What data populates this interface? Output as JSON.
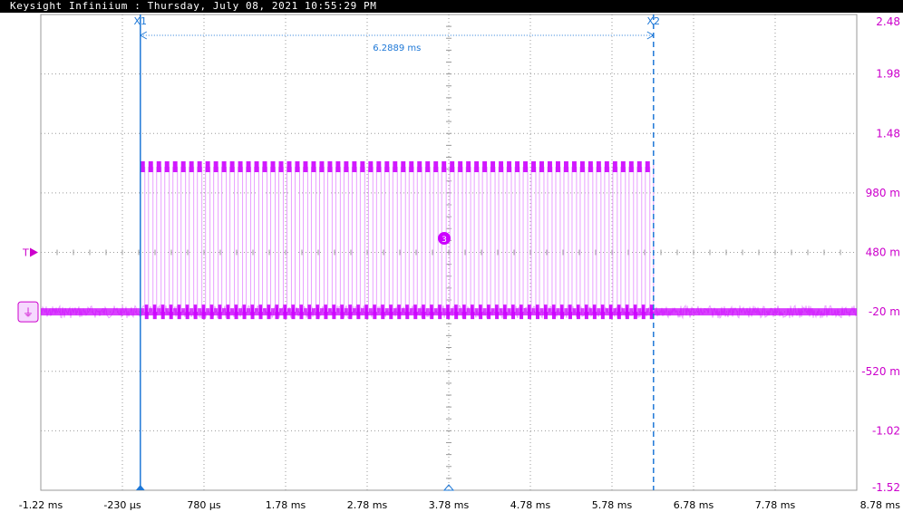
{
  "window": {
    "title": "Keysight Infiniium : Thursday, July 08, 2021 10:55:29 PM"
  },
  "colors": {
    "grid": "#9a9a9a",
    "trace": "#cc00ff",
    "trace_light": "#e9a0ff",
    "cursor": "#1e78d7",
    "y_labels": "#cc00cc",
    "x_labels": "#000000"
  },
  "markers": {
    "trigger_label": "T",
    "ground_label": "⏚",
    "channel_badge": "3"
  },
  "cursors": {
    "x1": {
      "label": "X1",
      "time_ms": -0.0
    },
    "x2": {
      "label": "X2",
      "time_ms": 6.2889
    },
    "delta_label": "6.2889 ms"
  },
  "chart_data": {
    "type": "line",
    "title": "",
    "xlabel": "",
    "ylabel": "",
    "x_tick_labels": [
      "-1.22 ms",
      "-230 µs",
      "780 µs",
      "1.78 ms",
      "2.78 ms",
      "3.78 ms",
      "4.78 ms",
      "5.78 ms",
      "6.78 ms",
      "7.78 ms",
      "8.78 ms"
    ],
    "x_ticks_ms": [
      -1.22,
      -0.23,
      0.78,
      1.78,
      2.78,
      3.78,
      4.78,
      5.78,
      6.78,
      7.78,
      8.78
    ],
    "y_tick_labels": [
      "2.48",
      "1.98",
      "1.48",
      "980 m",
      "480 m",
      "-20 m",
      "-520 m",
      "-1.02",
      "-1.52"
    ],
    "y_ticks_v": [
      2.48,
      1.98,
      1.48,
      0.98,
      0.48,
      -0.02,
      -0.52,
      -1.02,
      -1.52
    ],
    "xlim_ms": [
      -1.22,
      8.78
    ],
    "ylim_v": [
      -1.52,
      2.48
    ],
    "grid": true,
    "trigger_level_v": 0.48,
    "series": [
      {
        "name": "",
        "description_type": "pulse_train",
        "baseline_v": -0.02,
        "high_v": 1.2,
        "burst_start_ms": -0.0,
        "burst_end_ms": 6.2889,
        "pulse_count": 63
      }
    ]
  }
}
